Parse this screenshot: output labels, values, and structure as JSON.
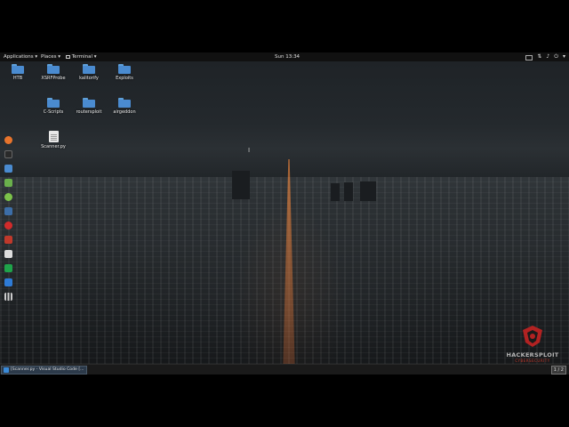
{
  "topbar": {
    "applications": "Applications ▾",
    "places": "Places ▾",
    "terminal": "Terminal ▾",
    "clock": "Sun 13:34",
    "tray_icons": [
      "screen-icon",
      "network-icon",
      "audio-icon",
      "power-icon"
    ]
  },
  "desktop": {
    "icons": [
      {
        "label": "HTB",
        "type": "folder"
      },
      {
        "label": "XSRFProbe",
        "type": "folder"
      },
      {
        "label": "kalitorify",
        "type": "folder"
      },
      {
        "label": "Exploits",
        "type": "folder"
      },
      {
        "label": "C-Scripts",
        "type": "folder"
      },
      {
        "label": "routersploit",
        "type": "folder"
      },
      {
        "label": "airgeddon",
        "type": "folder"
      },
      {
        "label": "Scanner.py",
        "type": "file"
      }
    ]
  },
  "dock": {
    "items": [
      {
        "name": "firefox-icon",
        "color": "#e8742c"
      },
      {
        "name": "terminal-icon",
        "color": "#2a2a2a"
      },
      {
        "name": "files-icon",
        "color": "#4a8bd0"
      },
      {
        "name": "notes-icon",
        "color": "#6ab04c"
      },
      {
        "name": "chat-icon",
        "color": "#7cc24a"
      },
      {
        "name": "metasploit-icon",
        "color": "#3c6ea8"
      },
      {
        "name": "armitage-icon",
        "color": "#d12b2b"
      },
      {
        "name": "burp-icon",
        "color": "#c0392b"
      },
      {
        "name": "tools-icon",
        "color": "#dddddd"
      },
      {
        "name": "hourglass-icon",
        "color": "#1fa34a"
      },
      {
        "name": "vscode-icon",
        "color": "#2e7bd6"
      },
      {
        "name": "app-grid-icon",
        "color": "#cccccc"
      }
    ]
  },
  "taskbar": {
    "task_label": "[Scanner.py - Visual Studio Code [...",
    "pager": "1 / 2"
  },
  "watermark": {
    "name": "HACKERSPLOIT",
    "sub": "CYBERSECURITY"
  }
}
